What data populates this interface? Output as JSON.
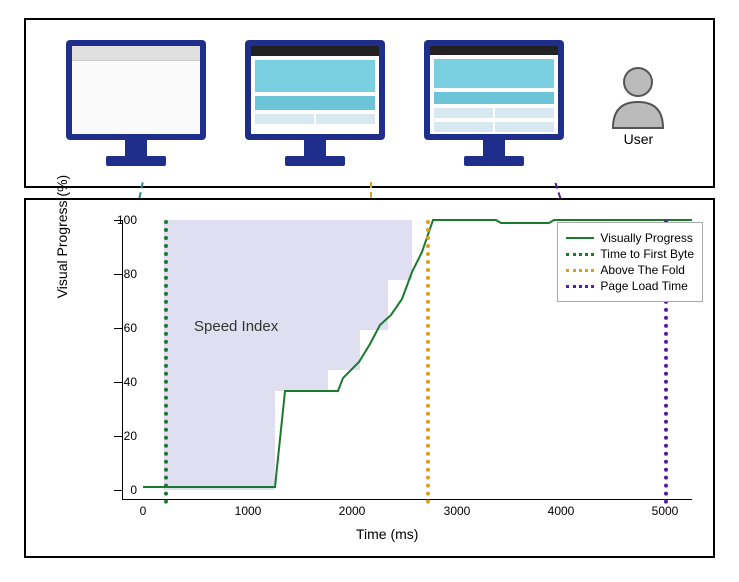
{
  "top": {
    "user_label": "User",
    "monitors": [
      {
        "state": "blank"
      },
      {
        "state": "partial"
      },
      {
        "state": "loaded"
      }
    ]
  },
  "legend": {
    "s1": "Visually Progress",
    "s2": "Time to First Byte",
    "s3": "Above The Fold",
    "s4": "Page Load Time"
  },
  "axes": {
    "ylabel": "Visual Progress (%)",
    "xlabel": "Time (ms)",
    "yticks": [
      "0",
      "20",
      "40",
      "60",
      "80",
      "100"
    ],
    "xticks": [
      "0",
      "1000",
      "2000",
      "3000",
      "4000",
      "5000"
    ]
  },
  "annotation": "Speed Index",
  "chart_data": {
    "type": "line",
    "title": "",
    "xlabel": "Time (ms)",
    "ylabel": "Visual Progress (%)",
    "xlim": [
      -200,
      5200
    ],
    "ylim": [
      -5,
      105
    ],
    "series": [
      {
        "name": "Visually Progress",
        "x": [
          0,
          200,
          1300,
          1400,
          1900,
          1950,
          2100,
          2200,
          2300,
          2400,
          2500,
          2600,
          2700,
          2750,
          3400,
          3450,
          3900,
          3950,
          5000,
          5200
        ],
        "y": [
          0,
          0,
          0,
          37,
          37,
          42,
          48,
          55,
          62,
          66,
          72,
          82,
          90,
          100,
          100,
          99,
          99,
          100,
          100,
          100
        ]
      }
    ],
    "vlines": [
      {
        "name": "Time to First Byte",
        "x": 200,
        "color": "#1a7a2e"
      },
      {
        "name": "Above The Fold",
        "x": 2700,
        "color": "#d9a020"
      },
      {
        "name": "Page Load Time",
        "x": 5000,
        "color": "#5a1d9e"
      }
    ],
    "shaded_region": {
      "label": "Speed Index",
      "description": "area between curve and 100% from x=200 to x=2750"
    }
  }
}
